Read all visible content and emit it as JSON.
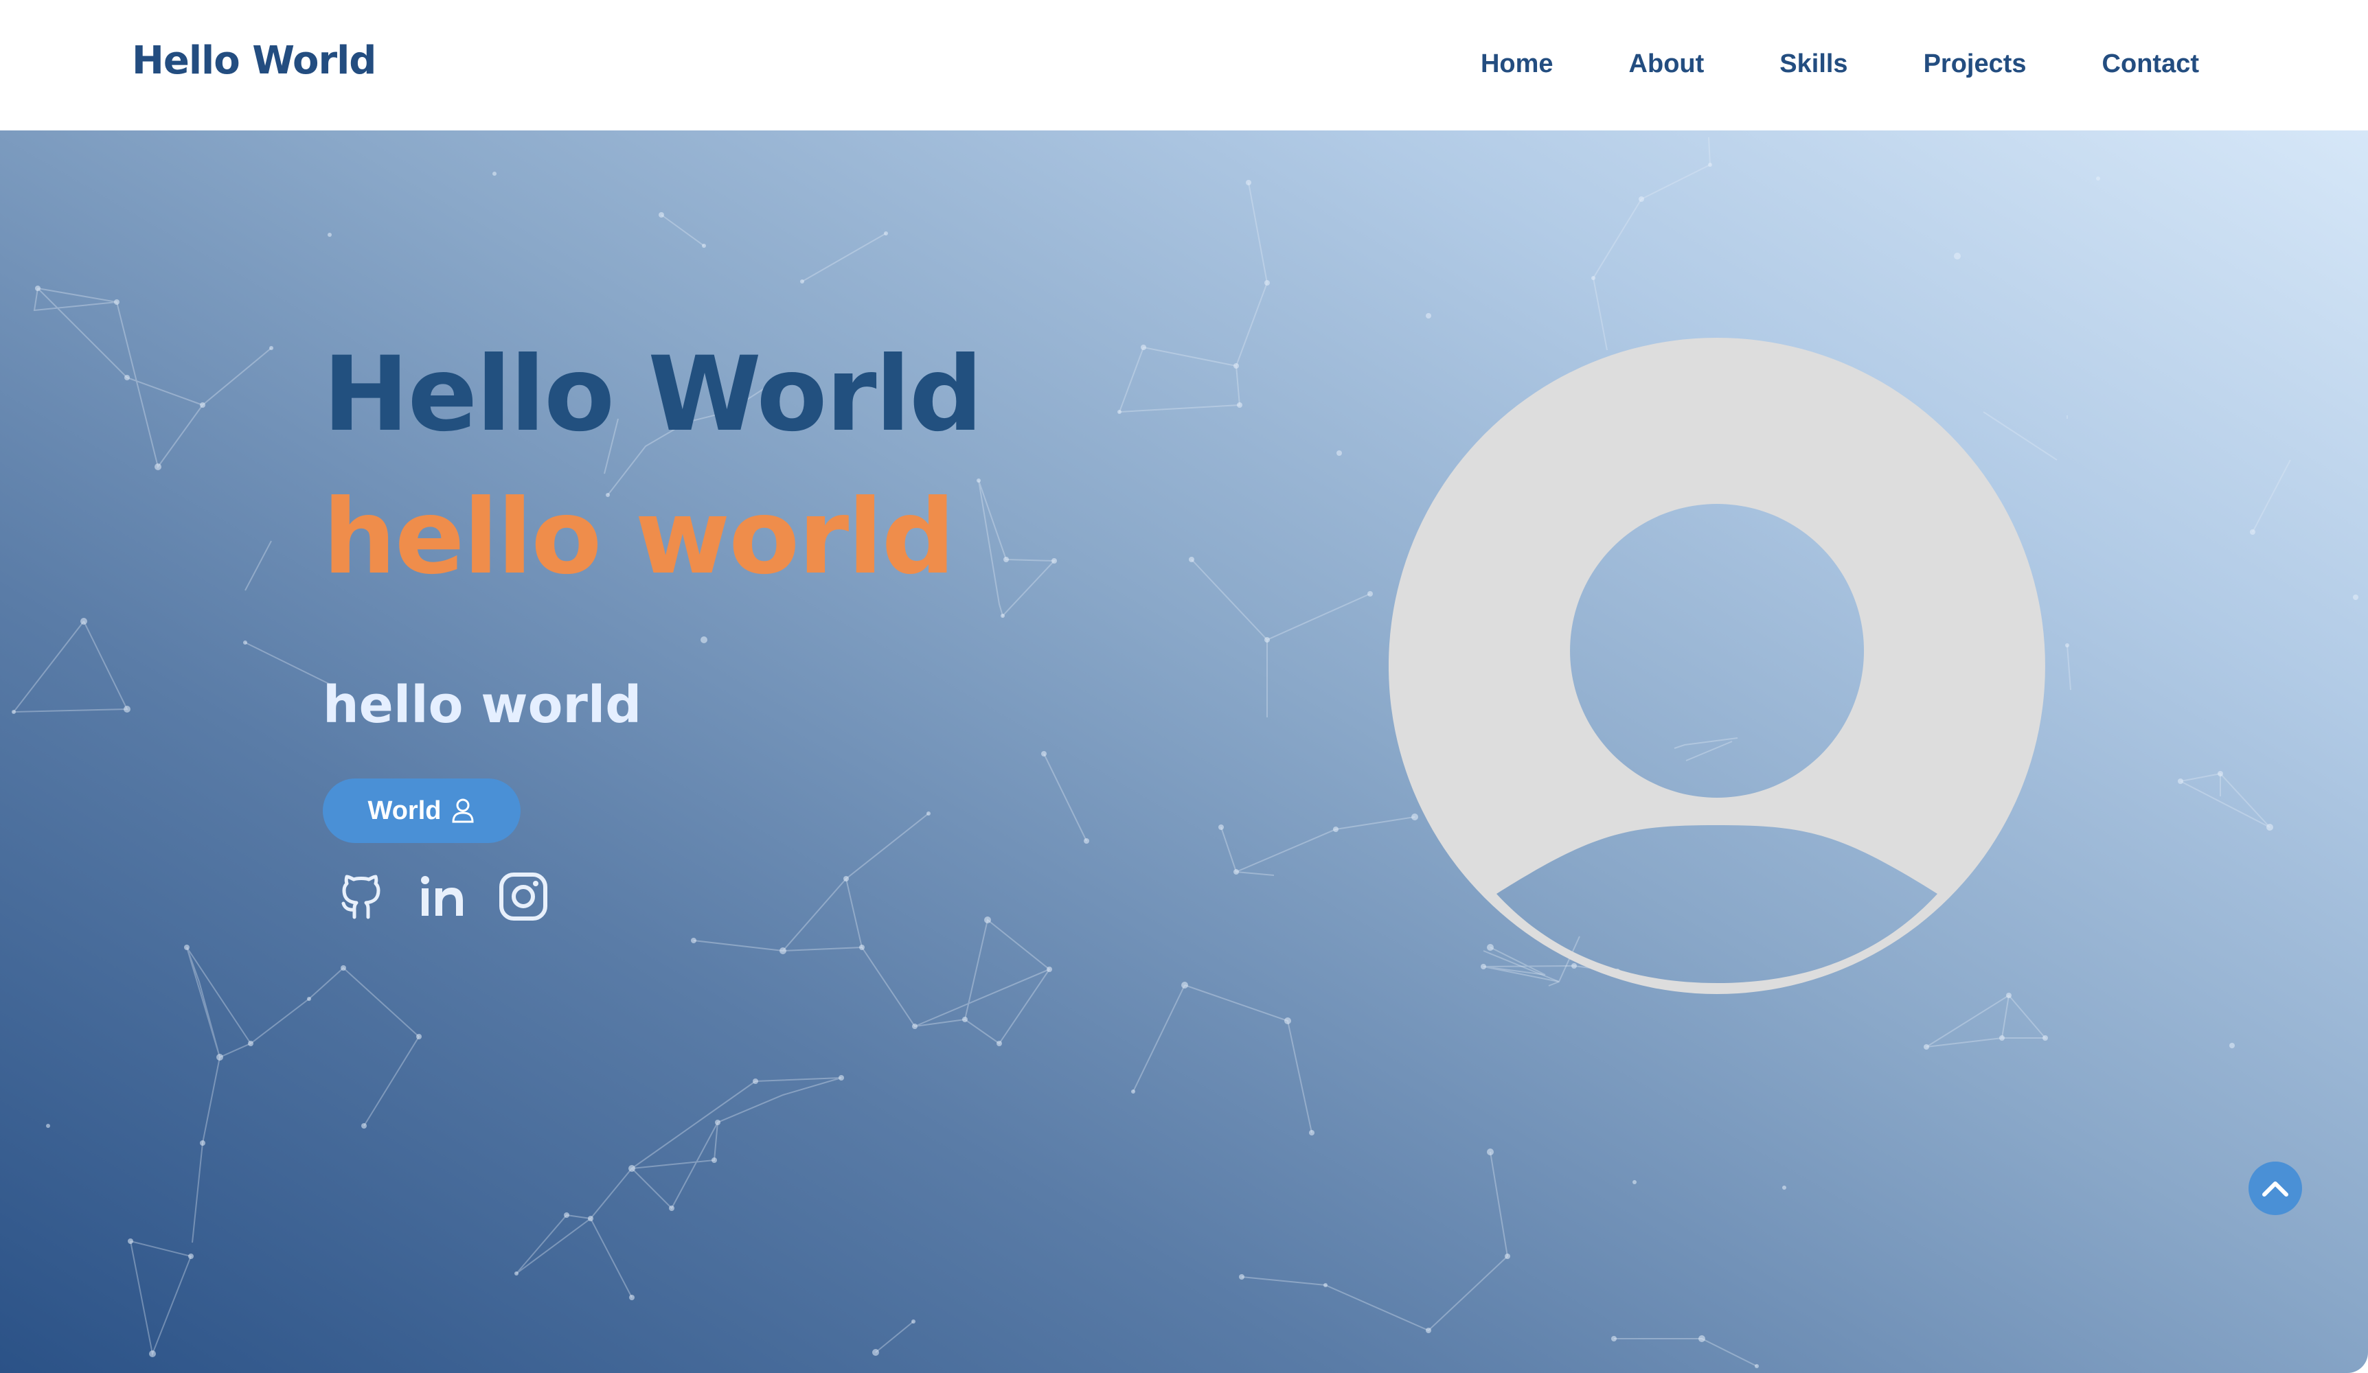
{
  "navbar": {
    "brand": "Hello World",
    "links": [
      "Home",
      "About",
      "Skills",
      "Projects",
      "Contact"
    ]
  },
  "hero": {
    "title_line1": "Hello World",
    "title_line2": "hello world",
    "subtitle": "hello world",
    "cta_label": "World",
    "cta_icon": "user-icon",
    "socials": [
      "github-icon",
      "linkedin-icon",
      "instagram-icon"
    ],
    "avatar": "avatar-placeholder-icon"
  },
  "scroll_top_icon": "chevron-up-icon",
  "colors": {
    "brand": "#234d80",
    "accent_orange": "#ef8d4b",
    "button_blue": "#4a90d6",
    "avatar_gray": "#dddddd"
  }
}
